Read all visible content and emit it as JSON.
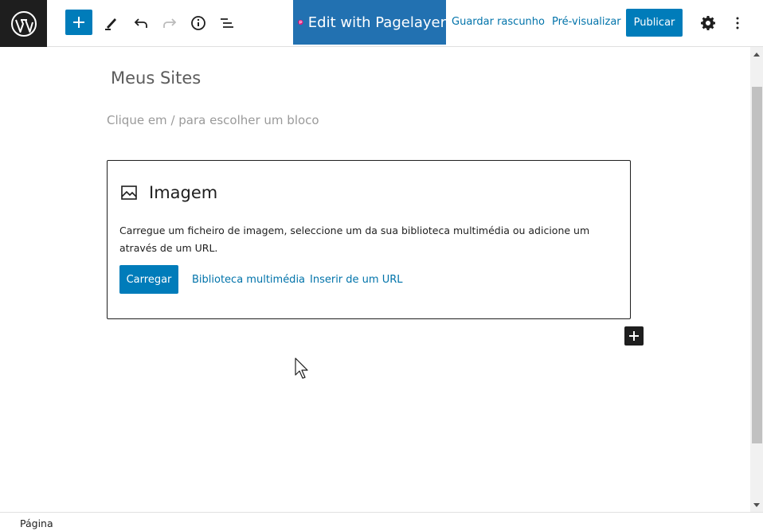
{
  "toolbar": {
    "logo_icon": "wordpress-logo-icon",
    "add_block_icon": "plus-icon",
    "tools_icon": "pencil-icon",
    "undo_icon": "undo-icon",
    "redo_icon": "redo-icon",
    "details_icon": "info-icon",
    "list_view_icon": "list-view-icon",
    "pagelayer_label": "Edit with Pagelayer",
    "save_draft_label": "Guardar rascunho",
    "preview_label": "Pré-visualizar",
    "publish_label": "Publicar",
    "settings_icon": "gear-icon",
    "more_icon": "vertical-ellipsis-icon"
  },
  "editor": {
    "page_title": "Meus Sites",
    "block_placeholder": "Clique em / para escolher um bloco",
    "image_block": {
      "title": "Imagem",
      "description": "Carregue um ficheiro de imagem, seleccione um da sua biblioteca multimédia ou adicione um através de um URL.",
      "upload_label": "Carregar",
      "media_library_label": "Biblioteca multimédia",
      "insert_url_label": "Inserir de um URL"
    }
  },
  "footer": {
    "breadcrumb": "Página"
  },
  "colors": {
    "accent": "#007cba",
    "pagelayer": "#2271b1",
    "dark": "#1e1e1e"
  }
}
